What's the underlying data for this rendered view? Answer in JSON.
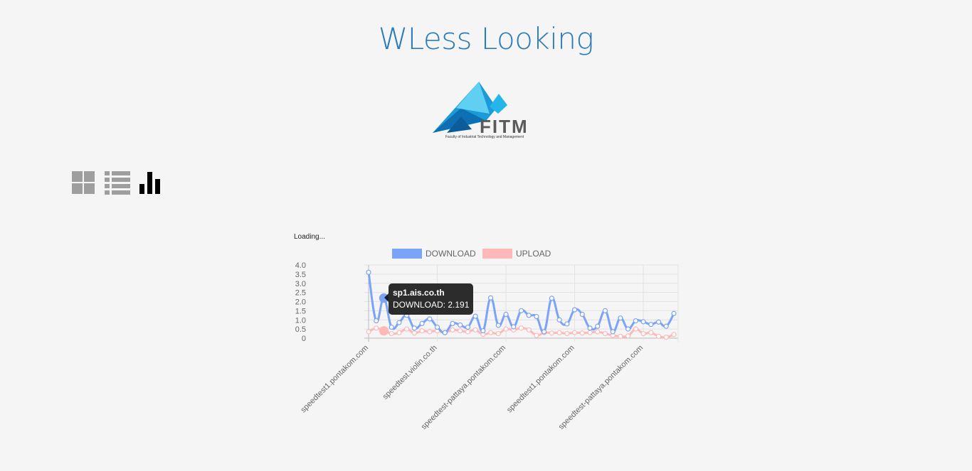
{
  "page": {
    "title": "WLess Looking",
    "loading_text": "Loading..."
  },
  "logo": {
    "text": "FITM",
    "subtitle": "Faculty of Industrial Technology and Management"
  },
  "view_icons": [
    {
      "name": "grid-view-icon",
      "active": false
    },
    {
      "name": "list-view-icon",
      "active": false
    },
    {
      "name": "bar-chart-view-icon",
      "active": true
    }
  ],
  "colors": {
    "title": "#2b7bb9",
    "download": "#7ba3f7",
    "upload": "#ffb8b8",
    "inactive_icon": "#9e9e9e",
    "active_icon": "#000000"
  },
  "tooltip": {
    "title": "sp1.ais.co.th",
    "body": "DOWNLOAD: 2.191"
  },
  "chart_data": {
    "type": "line",
    "legend": [
      "DOWNLOAD",
      "UPLOAD"
    ],
    "legend_position": "top",
    "grid": true,
    "ylim": [
      0,
      4.0
    ],
    "yticks": [
      "0",
      "0.5",
      "1.0",
      "1.5",
      "2.0",
      "2.5",
      "3.0",
      "3.5",
      "4.0"
    ],
    "xtick_labels": [
      "speedtest1.pontakom.com",
      "speedtest.violin.co.th",
      "speedtest-pattaya.pontakom.com",
      "speedtest1.pontakom.com",
      "speedtest-pattaya.pontakom.com"
    ],
    "xtick_indices": [
      0,
      9,
      18,
      27,
      36
    ],
    "series": [
      {
        "name": "DOWNLOAD",
        "values": [
          3.6,
          0.95,
          2.19,
          0.6,
          0.85,
          1.25,
          0.55,
          0.8,
          1.05,
          0.6,
          0.3,
          0.8,
          0.72,
          0.6,
          1.2,
          0.4,
          2.2,
          0.7,
          1.3,
          0.62,
          1.5,
          1.25,
          1.18,
          0.35,
          2.18,
          1.0,
          0.78,
          1.55,
          1.3,
          0.55,
          0.65,
          1.5,
          0.35,
          1.1,
          0.5,
          0.95,
          0.9,
          0.75,
          0.88,
          0.65,
          1.35
        ]
      },
      {
        "name": "UPLOAD",
        "values": [
          0.35,
          0.55,
          0.4,
          0.25,
          0.3,
          0.5,
          0.28,
          0.4,
          0.35,
          0.4,
          0.3,
          0.45,
          0.4,
          0.35,
          0.45,
          0.2,
          0.3,
          0.25,
          0.5,
          0.45,
          0.55,
          0.45,
          0.15,
          0.3,
          0.28,
          0.3,
          0.25,
          0.3,
          0.28,
          0.3,
          0.35,
          0.25,
          0.15,
          0.1,
          0.12,
          0.5,
          0.25,
          0.3,
          0.1,
          0.05,
          0.2
        ]
      }
    ]
  }
}
